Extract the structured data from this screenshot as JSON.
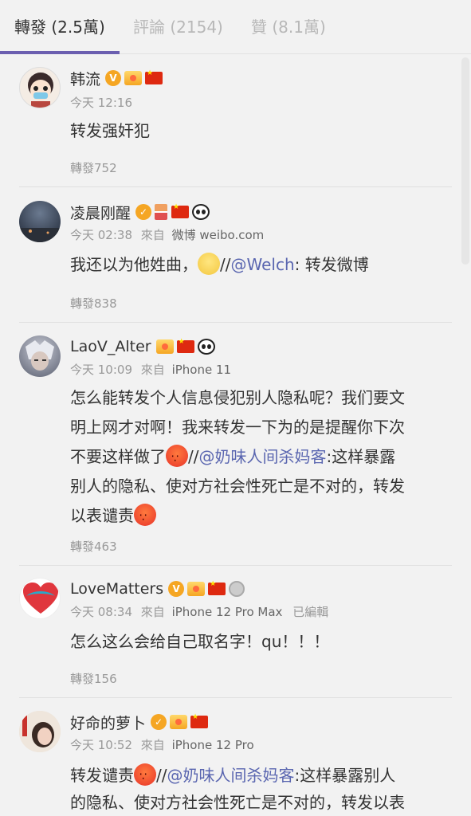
{
  "tabs": [
    {
      "label": "轉發 (2.5萬)"
    },
    {
      "label": "評論 (2154)"
    },
    {
      "label": "贊 (8.1萬)"
    }
  ],
  "posts": [
    {
      "name": "韩流",
      "time": "今天 12:16",
      "source_prefix": "",
      "source": "",
      "content": [
        "转发强奸犯"
      ],
      "repost_count": "轉發752"
    },
    {
      "name": "凌晨刚醒",
      "time": "今天 02:38",
      "source_prefix": "來自",
      "source": "微博 weibo.com",
      "content_a": "我还以为他姓曲，",
      "content_b": "//",
      "mention": "@Welch",
      "content_c": ": 转发微博",
      "repost_count": "轉發838"
    },
    {
      "name": "LaoV_Alter",
      "time": "今天 10:09",
      "source_prefix": "來自",
      "source": "iPhone 11",
      "line1": "怎么能转发个人信息侵犯别人隐私呢？我们要文",
      "line2": "明上网才对啊！我来转发一下为的是提醒你下次",
      "line3a": "不要这样做了",
      "line3b": "//",
      "mention": "@奶味人间杀妈客",
      "line3c": ":这样暴露",
      "line4": "别人的隐私、使对方社会性死亡是不对的，转发",
      "line5": "以表谴责",
      "repost_count": "轉發463"
    },
    {
      "name": "LoveMatters",
      "time": "今天 08:34",
      "source_prefix": "來自",
      "source": "iPhone 12 Pro Max",
      "edited": "已編輯",
      "content": "怎么这么会给自己取名字！qu！！！",
      "repost_count": "轉發156"
    },
    {
      "name": "好命的萝卜",
      "time": "今天 10:52",
      "source_prefix": "來自",
      "source": "iPhone 12 Pro",
      "line1a": "转发谴责",
      "line1b": "//",
      "mention": "@奶味人间杀妈客",
      "line1c": ":这样暴露别人",
      "line2": "的隐私、使对方社会性死亡是不对的，转发以表"
    }
  ],
  "colors": {
    "accent": "#6b5fb0",
    "mention": "#5a66b0",
    "background": "#f2f2f2",
    "text": "#333333",
    "meta": "#999999"
  }
}
